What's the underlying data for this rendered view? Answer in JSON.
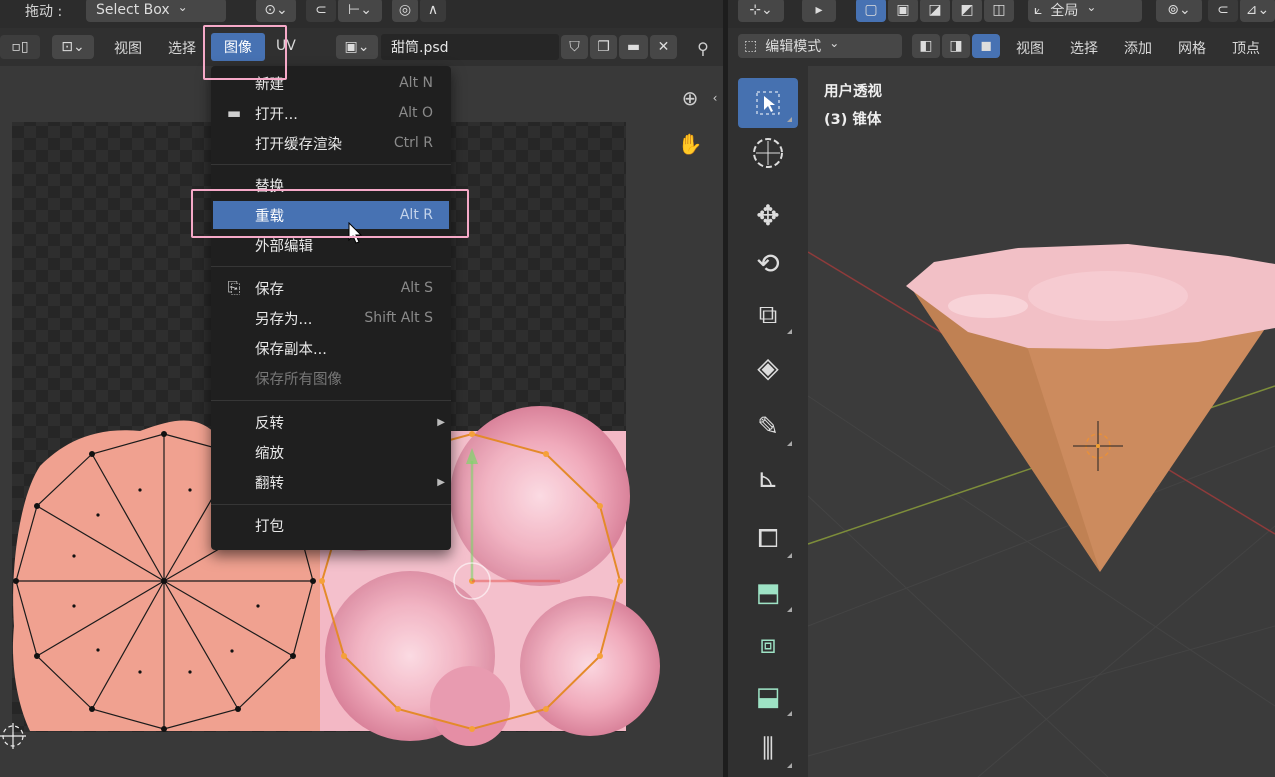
{
  "left_header": {
    "drag_label": "拖动 :",
    "select_mode": "Select Box"
  },
  "uv_header": {
    "menu_view": "视图",
    "menu_select": "选择",
    "menu_image": "图像",
    "menu_uv": "UV",
    "image_name": "甜筒.psd"
  },
  "image_menu": {
    "items": [
      {
        "label": "新建",
        "shortcut": "Alt N"
      },
      {
        "label": "打开...",
        "shortcut": "Alt O"
      },
      {
        "label": "打开缓存渲染",
        "shortcut": "Ctrl R"
      },
      {
        "label": "替换..."
      },
      {
        "label": "重载",
        "shortcut": "Alt R"
      },
      {
        "label": "外部编辑"
      },
      {
        "label": "保存",
        "shortcut": "Alt S"
      },
      {
        "label": "另存为...",
        "shortcut": "Shift Alt S"
      },
      {
        "label": "保存副本..."
      },
      {
        "label": "保存所有图像"
      },
      {
        "label": "反转"
      },
      {
        "label": "缩放"
      },
      {
        "label": "翻转"
      },
      {
        "label": "打包"
      }
    ],
    "highlighted": "重载"
  },
  "right_header": {
    "transform_orientation": "全局",
    "mode": "编辑模式",
    "menu_view": "视图",
    "menu_select": "选择",
    "menu_add": "添加",
    "menu_mesh": "网格",
    "menu_vertex": "顶点"
  },
  "viewport": {
    "view_name": "用户透视",
    "object_label": "(3) 锥体"
  },
  "colors": {
    "accent_blue": "#4772b3",
    "highlight_pink": "#f6a9c8",
    "uv_face": "#f0a190",
    "cone_body": "#cc8b5e",
    "cone_top": "#f2c0c6"
  }
}
